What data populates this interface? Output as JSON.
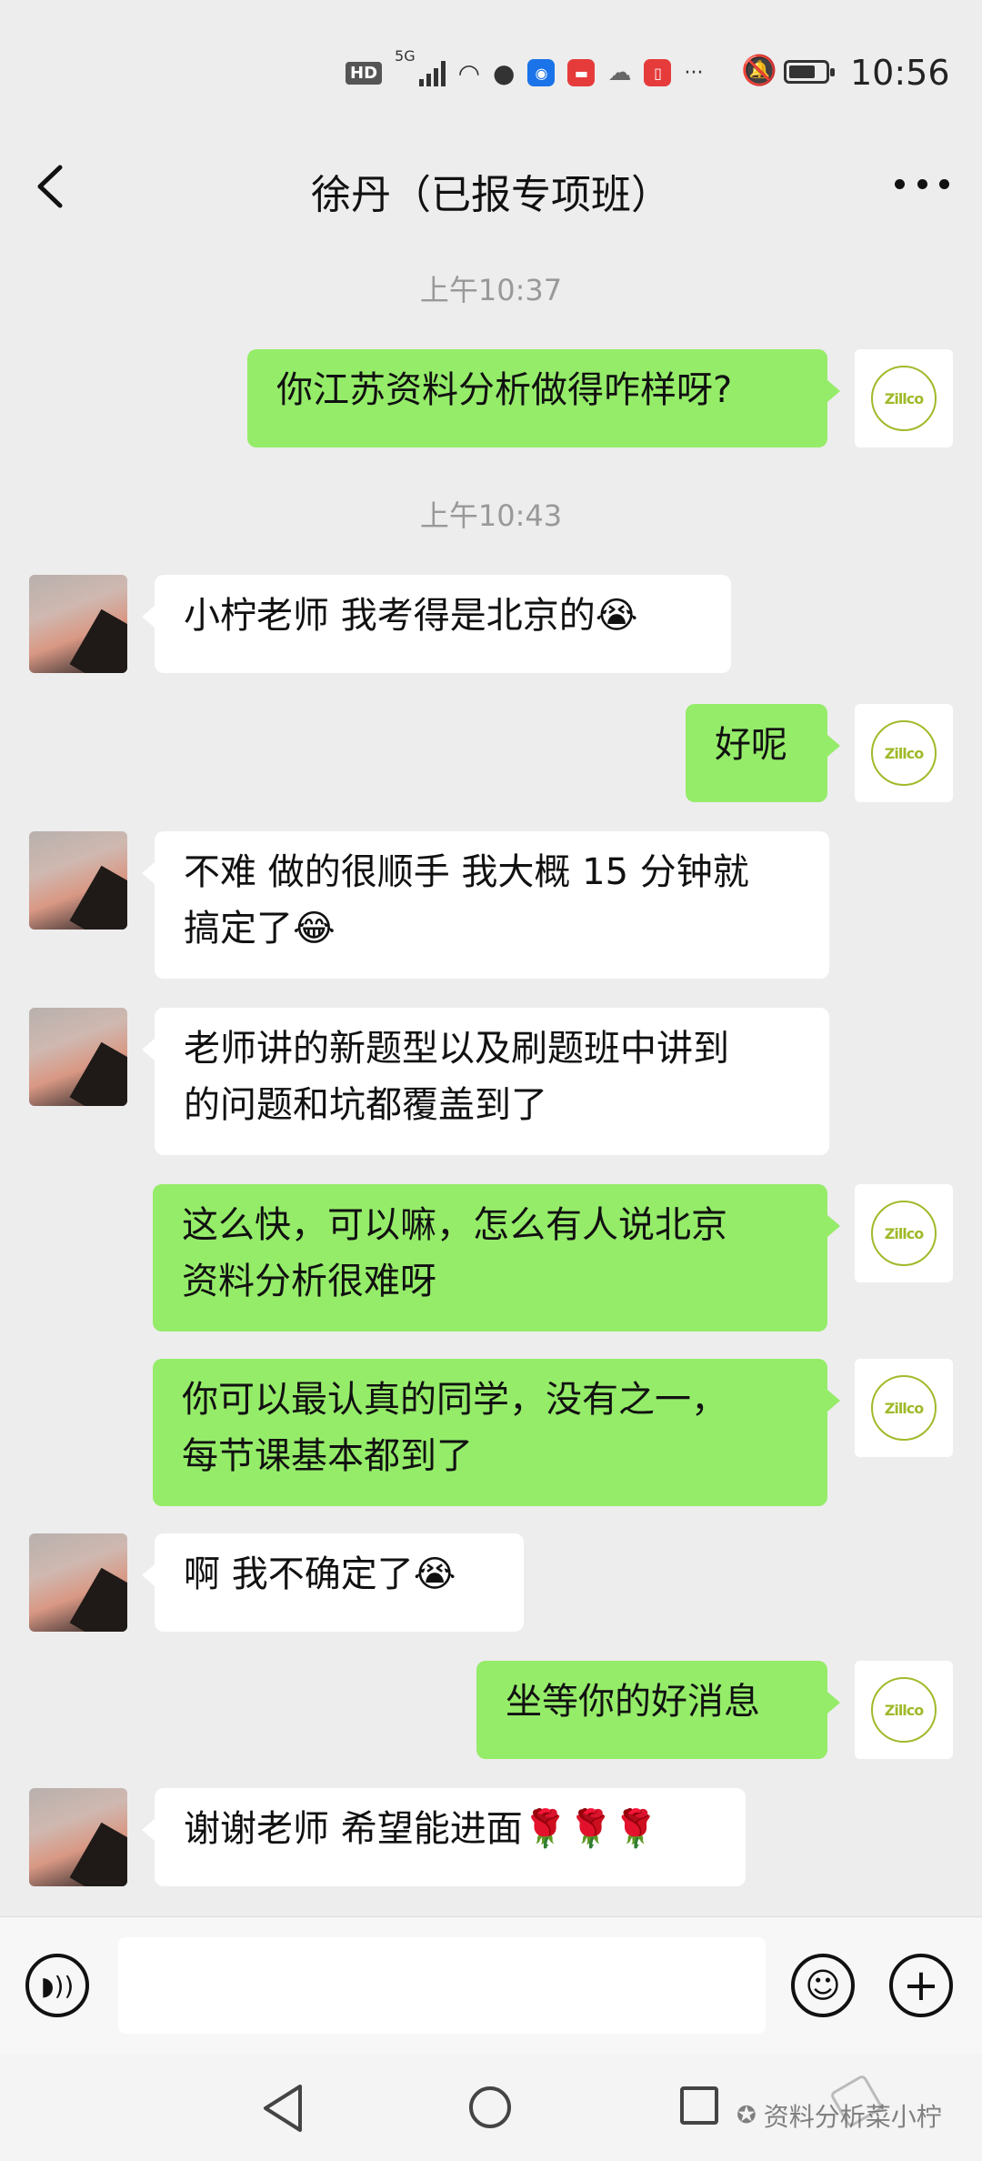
{
  "status_bar": {
    "hd": "HD",
    "network": "5G",
    "time": "10:56",
    "more": "···"
  },
  "nav": {
    "title": "徐丹（已报专项班）"
  },
  "self_avatar_text": "Zillco",
  "messages": [
    {
      "type": "time",
      "text": "上午10:37"
    },
    {
      "type": "out",
      "text": "你江苏资料分析做得咋样呀?"
    },
    {
      "type": "time",
      "text": "上午10:43"
    },
    {
      "type": "in",
      "text": "小柠老师 我考得是北京的😭"
    },
    {
      "type": "out",
      "text": "好呢"
    },
    {
      "type": "in",
      "text": "不难 做的很顺手 我大概 15 分钟就\n搞定了😂"
    },
    {
      "type": "in",
      "text": "老师讲的新题型以及刷题班中讲到\n的问题和坑都覆盖到了"
    },
    {
      "type": "out",
      "text": "这么快，可以嘛，怎么有人说北京\n资料分析很难呀"
    },
    {
      "type": "out",
      "text": "你可以最认真的同学，没有之一，\n每节课基本都到了"
    },
    {
      "type": "in",
      "text": "啊 我不确定了😭"
    },
    {
      "type": "out",
      "text": "坐等你的好消息"
    },
    {
      "type": "in",
      "text": "谢谢老师 希望能进面🌹🌹🌹"
    }
  ],
  "input_bar": {
    "placeholder": ""
  },
  "watermark": "资料分析菜小柠"
}
